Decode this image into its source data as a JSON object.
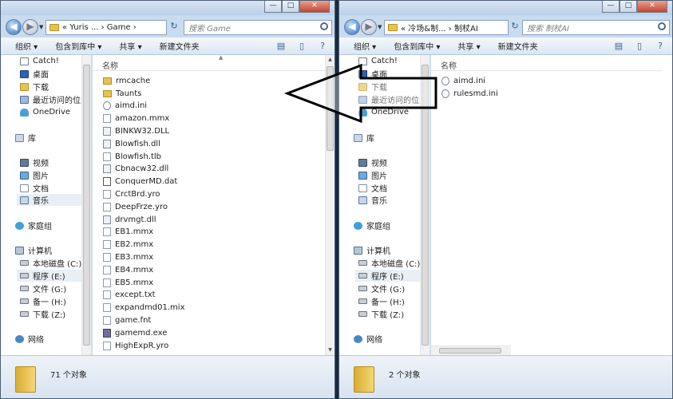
{
  "left_window": {
    "caption_buttons": [
      "—",
      "□",
      "✕"
    ],
    "nav": {
      "back": "◀",
      "forward": "▶",
      "dropdown": "▼"
    },
    "address": "« Yuris ... › Game ›",
    "search_placeholder": "搜索 Game",
    "toolbar": {
      "organize": "组织 ▾",
      "include_in_library": "包含到库中 ▾",
      "share": "共享 ▾",
      "new_folder": "新建文件夹"
    },
    "nav_items": [
      {
        "label": "Catch!",
        "icon": "catch-icon"
      },
      {
        "label": "桌面",
        "icon": "desktop-icon"
      },
      {
        "label": "下载",
        "icon": "folder-icon"
      },
      {
        "label": "最近访问的位置",
        "icon": "recent-icon"
      },
      {
        "label": "OneDrive",
        "icon": "onedrive-icon"
      },
      {
        "label": "库",
        "icon": "library-icon"
      },
      {
        "label": "视频",
        "icon": "video-icon"
      },
      {
        "label": "图片",
        "icon": "picture-icon"
      },
      {
        "label": "文档",
        "icon": "document-icon"
      },
      {
        "label": "音乐",
        "icon": "music-icon"
      },
      {
        "label": "家庭组",
        "icon": "homegroup-icon"
      },
      {
        "label": "计算机",
        "icon": "computer-icon"
      },
      {
        "label": "本地磁盘 (C:)",
        "icon": "drive-icon"
      },
      {
        "label": "程序 (E:)",
        "icon": "drive-icon"
      },
      {
        "label": "文件 (G:)",
        "icon": "drive-icon"
      },
      {
        "label": "备一 (H:)",
        "icon": "drive-icon"
      },
      {
        "label": "下载 (Z:)",
        "icon": "drive-icon"
      },
      {
        "label": "网络",
        "icon": "network-icon"
      }
    ],
    "column_name": "名称",
    "files": [
      {
        "name": "rmcache",
        "type": "folder"
      },
      {
        "name": "Taunts",
        "type": "folder"
      },
      {
        "name": "aimd.ini",
        "type": "ini"
      },
      {
        "name": "amazon.mmx",
        "type": "file"
      },
      {
        "name": "BINKW32.DLL",
        "type": "dll"
      },
      {
        "name": "Blowfish.dll",
        "type": "dll"
      },
      {
        "name": "Blowfish.tlb",
        "type": "file"
      },
      {
        "name": "Cbnacw32.dll",
        "type": "dll"
      },
      {
        "name": "ConquerMD.dat",
        "type": "dat"
      },
      {
        "name": "CrctBrd.yro",
        "type": "file"
      },
      {
        "name": "DeepFrze.yro",
        "type": "file"
      },
      {
        "name": "drvmgt.dll",
        "type": "dll"
      },
      {
        "name": "EB1.mmx",
        "type": "file"
      },
      {
        "name": "EB2.mmx",
        "type": "file"
      },
      {
        "name": "EB3.mmx",
        "type": "file"
      },
      {
        "name": "EB4.mmx",
        "type": "file"
      },
      {
        "name": "EB5.mmx",
        "type": "file"
      },
      {
        "name": "except.txt",
        "type": "file"
      },
      {
        "name": "expandmd01.mix",
        "type": "file"
      },
      {
        "name": "game.fnt",
        "type": "file"
      },
      {
        "name": "gamemd.exe",
        "type": "exe"
      },
      {
        "name": "HighExpR.yro",
        "type": "file"
      }
    ],
    "status": "71 个对象"
  },
  "right_window": {
    "caption_buttons": [
      "—",
      "□",
      "✕"
    ],
    "nav": {
      "back": "◀",
      "forward": "▶",
      "dropdown": "▼"
    },
    "address": "« 冷场&制... › 制杖AI",
    "search_placeholder": "搜索 制杖AI",
    "toolbar": {
      "organize": "组织 ▾",
      "include_in_library": "包含到库中 ▾",
      "share": "共享 ▾",
      "new_folder": "新建文件夹"
    },
    "nav_items": [
      {
        "label": "Catch!",
        "icon": "catch-icon"
      },
      {
        "label": "桌面",
        "icon": "desktop-icon"
      },
      {
        "label": "下载",
        "icon": "folder-icon"
      },
      {
        "label": "最近访问的位置",
        "icon": "recent-icon"
      },
      {
        "label": "OneDrive",
        "icon": "onedrive-icon"
      },
      {
        "label": "库",
        "icon": "library-icon"
      },
      {
        "label": "视频",
        "icon": "video-icon"
      },
      {
        "label": "图片",
        "icon": "picture-icon"
      },
      {
        "label": "文档",
        "icon": "document-icon"
      },
      {
        "label": "音乐",
        "icon": "music-icon"
      },
      {
        "label": "家庭组",
        "icon": "homegroup-icon"
      },
      {
        "label": "计算机",
        "icon": "computer-icon"
      },
      {
        "label": "本地磁盘 (C:)",
        "icon": "drive-icon"
      },
      {
        "label": "程序 (E:)",
        "icon": "drive-icon"
      },
      {
        "label": "文件 (G:)",
        "icon": "drive-icon"
      },
      {
        "label": "备一 (H:)",
        "icon": "drive-icon"
      },
      {
        "label": "下载 (Z:)",
        "icon": "drive-icon"
      },
      {
        "label": "网络",
        "icon": "network-icon"
      }
    ],
    "column_name": "名称",
    "files": [
      {
        "name": "aimd.ini",
        "type": "ini"
      },
      {
        "name": "rulesmd.ini",
        "type": "ini"
      }
    ],
    "status": "2 个对象"
  },
  "colors": {
    "window_frame": "#c9dbee",
    "background": "#1b2b3f",
    "annotation": "#000000"
  }
}
